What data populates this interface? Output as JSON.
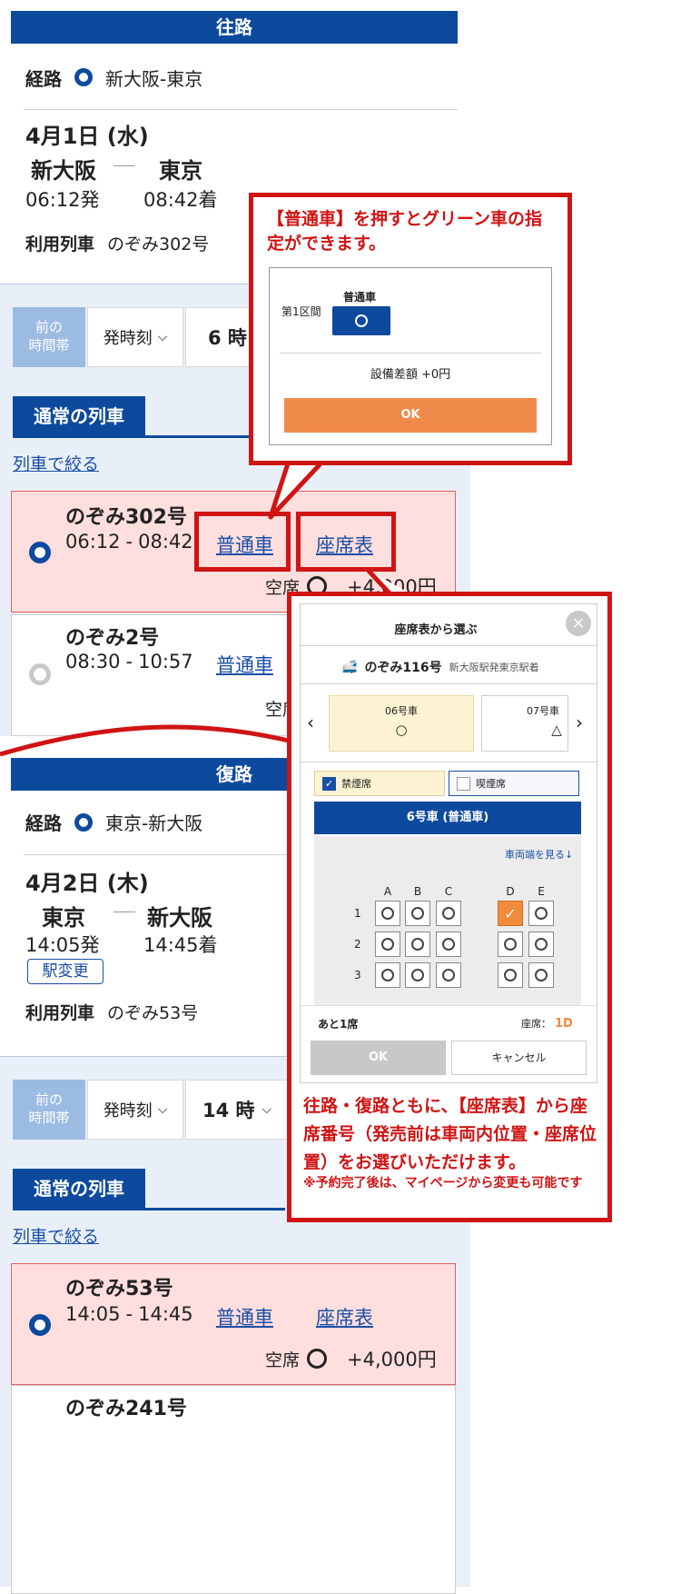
{
  "outbound": {
    "header": "往路",
    "route_label": "経路",
    "route_value": "新大阪-東京",
    "date": "4月1日 (水)",
    "from": "新大阪",
    "to": "東京",
    "dep": "06:12発",
    "arr": "08:42着",
    "train_label": "利用列車",
    "train_value": "のぞみ302号",
    "prev_slot": "前の\n時間帯",
    "dep_time_select": "発時刻",
    "hour": "6 時",
    "section": "通常の列車",
    "filter": "列車で絞る",
    "cards": [
      {
        "name": "のぞみ302号",
        "dep": "06:12",
        "arr": "08:42",
        "car": "普通車",
        "seatmap": "座席表",
        "vacancy": "空席",
        "price": "+4,000円"
      },
      {
        "name": "のぞみ2号",
        "dep": "08:30",
        "arr": "10:57",
        "car": "普通車",
        "vacancy": "空席"
      }
    ]
  },
  "return": {
    "header": "復路",
    "route_label": "経路",
    "route_value": "東京-新大阪",
    "date": "4月2日 (木)",
    "from": "東京",
    "to": "新大阪",
    "dep": "14:05発",
    "arr": "14:45着",
    "station_change": "駅変更",
    "train_label": "利用列車",
    "train_value": "のぞみ53号",
    "prev_slot": "前の\n時間帯",
    "dep_time_select": "発時刻",
    "hour": "14 時",
    "section": "通常の列車",
    "filter": "列車で絞る",
    "cards": [
      {
        "name": "のぞみ53号",
        "dep": "14:05",
        "arr": "14:45",
        "car": "普通車",
        "seatmap": "座席表",
        "vacancy": "空席",
        "price": "+4,000円"
      },
      {
        "name": "のぞみ241号"
      }
    ]
  },
  "callout_top": {
    "text": "【普通車】を押すとグリーン車の指定ができます。",
    "popup": {
      "section_label": "第1区間",
      "car_label": "普通車",
      "diff": "設備差額 +0円",
      "ok": "OK"
    }
  },
  "callout_seat": {
    "title": "座席表から選ぶ",
    "train": "のぞみ116号",
    "route": "新大阪駅発東京駅着",
    "car_tabs": [
      {
        "label": "06号車",
        "mark": "○"
      },
      {
        "label": "07号車",
        "mark": "△"
      }
    ],
    "nonsmoking": "禁煙席",
    "smoking": "喫煙席",
    "car_header": "6号車 (普通車)",
    "see_end": "車両端を見る↓",
    "cols_left": [
      "A",
      "B",
      "C"
    ],
    "cols_right": [
      "D",
      "E"
    ],
    "rows": [
      "1",
      "2",
      "3"
    ],
    "remaining": "あと1席",
    "seat_label": "座席：",
    "seat_value": "1D",
    "ok": "OK",
    "cancel": "キャンセル",
    "note_main": "往路・復路ともに、【座席表】から座席番号（発売前は車両内位置・座席位置）をお選びいただけます。",
    "note_sub": "※予約完了後は、マイページから変更も可能です"
  },
  "colors": {
    "navy": "#0d4a9e",
    "red": "#d01414",
    "orange": "#f08a3c",
    "pink": "#ffdede"
  }
}
